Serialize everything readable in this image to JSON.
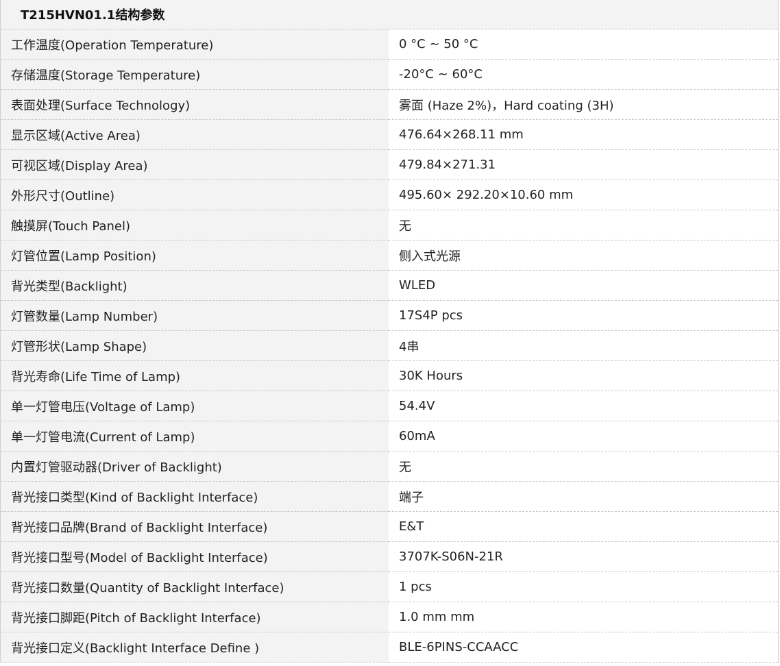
{
  "table": {
    "title": "T215HVN01.1结构参数",
    "rows": [
      {
        "label": "工作温度(Operation Temperature)",
        "value": "0 °C ~ 50 °C"
      },
      {
        "label": "存储温度(Storage Temperature)",
        "value": "-20°C ~ 60°C"
      },
      {
        "label": "表面处理(Surface Technology)",
        "value": "雾面 (Haze 2%)，Hard coating (3H)"
      },
      {
        "label": "显示区域(Active Area)",
        "value": "476.64×268.11 mm"
      },
      {
        "label": "可视区域(Display Area)",
        "value": "479.84×271.31"
      },
      {
        "label": "外形尺寸(Outline)",
        "value": "495.60× 292.20×10.60 mm"
      },
      {
        "label": "触摸屏(Touch Panel)",
        "value": "无"
      },
      {
        "label": "灯管位置(Lamp Position)",
        "value": "侧入式光源"
      },
      {
        "label": "背光类型(Backlight)",
        "value": "WLED"
      },
      {
        "label": "灯管数量(Lamp Number)",
        "value": "17S4P pcs"
      },
      {
        "label": "灯管形状(Lamp Shape)",
        "value": "4串"
      },
      {
        "label": "背光寿命(Life Time of Lamp)",
        "value": "30K Hours"
      },
      {
        "label": "单一灯管电压(Voltage of Lamp)",
        "value": "54.4V"
      },
      {
        "label": "单一灯管电流(Current of Lamp)",
        "value": "60mA"
      },
      {
        "label": "内置灯管驱动器(Driver of Backlight)",
        "value": "无"
      },
      {
        "label": "背光接口类型(Kind of Backlight Interface)",
        "value": "端子"
      },
      {
        "label": "背光接口品牌(Brand of Backlight Interface)",
        "value": "E&T"
      },
      {
        "label": "背光接口型号(Model of Backlight Interface)",
        "value": "3707K-S06N-21R"
      },
      {
        "label": "背光接口数量(Quantity of Backlight Interface)",
        "value": "1 pcs"
      },
      {
        "label": "背光接口脚距(Pitch of Backlight Interface)",
        "value": "1.0 mm mm"
      },
      {
        "label": "背光接口定义(Backlight Interface Define )",
        "value": "BLE-6PINS-CCAACC"
      }
    ]
  }
}
